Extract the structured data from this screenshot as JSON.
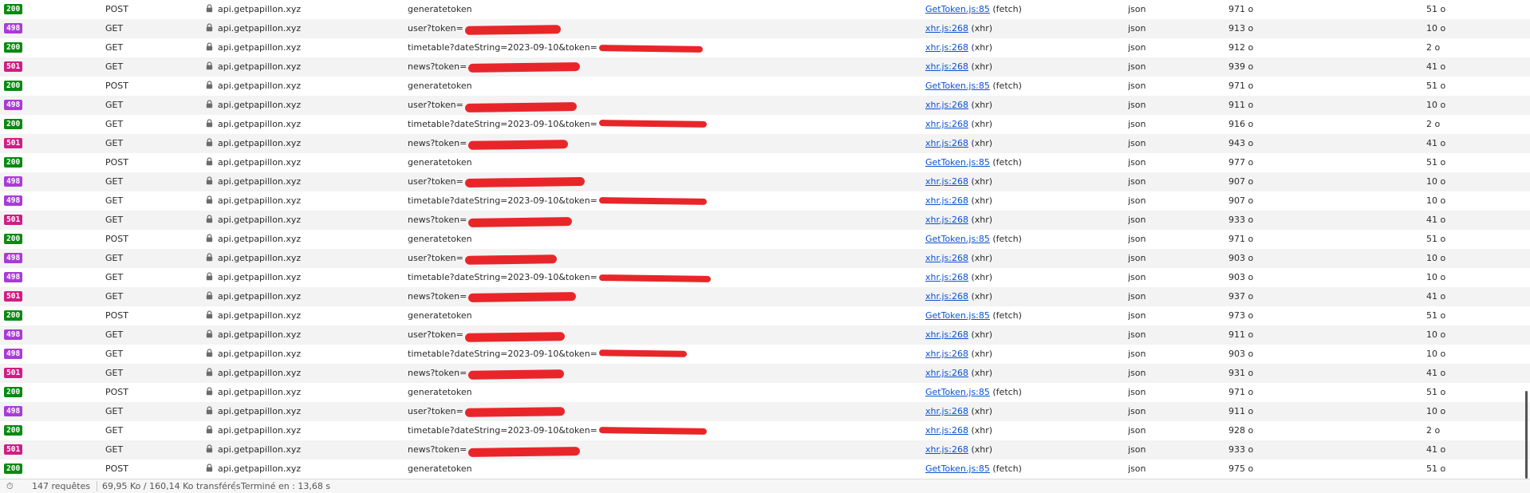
{
  "colors": {
    "ok": "#098a11",
    "blocked": "#a83bd8",
    "server_error": "#cf1d84",
    "link": "#0b52d0",
    "redaction": "#e8262a"
  },
  "rows": [
    {
      "status": "200",
      "method": "POST",
      "domain": "api.getpapillon.xyz",
      "file": "generatetoken",
      "initiator_link": "GetToken.js:85",
      "initiator_kind": "(fetch)",
      "type": "json",
      "transferred": "971 o",
      "size": "51 o",
      "redact": false
    },
    {
      "status": "498",
      "method": "GET",
      "domain": "api.getpapillon.xyz",
      "file": "user?token=",
      "initiator_link": "xhr.js:268",
      "initiator_kind": "(xhr)",
      "type": "json",
      "transferred": "913 o",
      "size": "10 o",
      "redact": true
    },
    {
      "status": "200",
      "method": "GET",
      "domain": "api.getpapillon.xyz",
      "file": "timetable?dateString=2023-09-10&token=",
      "initiator_link": "xhr.js:268",
      "initiator_kind": "(xhr)",
      "type": "json",
      "transferred": "912 o",
      "size": "2 o",
      "redact": true
    },
    {
      "status": "501",
      "method": "GET",
      "domain": "api.getpapillon.xyz",
      "file": "news?token=",
      "initiator_link": "xhr.js:268",
      "initiator_kind": "(xhr)",
      "type": "json",
      "transferred": "939 o",
      "size": "41 o",
      "redact": true
    },
    {
      "status": "200",
      "method": "POST",
      "domain": "api.getpapillon.xyz",
      "file": "generatetoken",
      "initiator_link": "GetToken.js:85",
      "initiator_kind": "(fetch)",
      "type": "json",
      "transferred": "971 o",
      "size": "51 o",
      "redact": false
    },
    {
      "status": "498",
      "method": "GET",
      "domain": "api.getpapillon.xyz",
      "file": "user?token=",
      "initiator_link": "xhr.js:268",
      "initiator_kind": "(xhr)",
      "type": "json",
      "transferred": "911 o",
      "size": "10 o",
      "redact": true
    },
    {
      "status": "200",
      "method": "GET",
      "domain": "api.getpapillon.xyz",
      "file": "timetable?dateString=2023-09-10&token=",
      "initiator_link": "xhr.js:268",
      "initiator_kind": "(xhr)",
      "type": "json",
      "transferred": "916 o",
      "size": "2 o",
      "redact": true
    },
    {
      "status": "501",
      "method": "GET",
      "domain": "api.getpapillon.xyz",
      "file": "news?token=",
      "initiator_link": "xhr.js:268",
      "initiator_kind": "(xhr)",
      "type": "json",
      "transferred": "943 o",
      "size": "41 o",
      "redact": true
    },
    {
      "status": "200",
      "method": "POST",
      "domain": "api.getpapillon.xyz",
      "file": "generatetoken",
      "initiator_link": "GetToken.js:85",
      "initiator_kind": "(fetch)",
      "type": "json",
      "transferred": "977 o",
      "size": "51 o",
      "redact": false
    },
    {
      "status": "498",
      "method": "GET",
      "domain": "api.getpapillon.xyz",
      "file": "user?token=",
      "initiator_link": "xhr.js:268",
      "initiator_kind": "(xhr)",
      "type": "json",
      "transferred": "907 o",
      "size": "10 o",
      "redact": true
    },
    {
      "status": "498",
      "method": "GET",
      "domain": "api.getpapillon.xyz",
      "file": "timetable?dateString=2023-09-10&token=",
      "initiator_link": "xhr.js:268",
      "initiator_kind": "(xhr)",
      "type": "json",
      "transferred": "907 o",
      "size": "10 o",
      "redact": true
    },
    {
      "status": "501",
      "method": "GET",
      "domain": "api.getpapillon.xyz",
      "file": "news?token=",
      "initiator_link": "xhr.js:268",
      "initiator_kind": "(xhr)",
      "type": "json",
      "transferred": "933 o",
      "size": "41 o",
      "redact": true
    },
    {
      "status": "200",
      "method": "POST",
      "domain": "api.getpapillon.xyz",
      "file": "generatetoken",
      "initiator_link": "GetToken.js:85",
      "initiator_kind": "(fetch)",
      "type": "json",
      "transferred": "971 o",
      "size": "51 o",
      "redact": false
    },
    {
      "status": "498",
      "method": "GET",
      "domain": "api.getpapillon.xyz",
      "file": "user?token=",
      "initiator_link": "xhr.js:268",
      "initiator_kind": "(xhr)",
      "type": "json",
      "transferred": "903 o",
      "size": "10 o",
      "redact": true
    },
    {
      "status": "498",
      "method": "GET",
      "domain": "api.getpapillon.xyz",
      "file": "timetable?dateString=2023-09-10&token=",
      "initiator_link": "xhr.js:268",
      "initiator_kind": "(xhr)",
      "type": "json",
      "transferred": "903 o",
      "size": "10 o",
      "redact": true
    },
    {
      "status": "501",
      "method": "GET",
      "domain": "api.getpapillon.xyz",
      "file": "news?token=",
      "initiator_link": "xhr.js:268",
      "initiator_kind": "(xhr)",
      "type": "json",
      "transferred": "937 o",
      "size": "41 o",
      "redact": true
    },
    {
      "status": "200",
      "method": "POST",
      "domain": "api.getpapillon.xyz",
      "file": "generatetoken",
      "initiator_link": "GetToken.js:85",
      "initiator_kind": "(fetch)",
      "type": "json",
      "transferred": "973 o",
      "size": "51 o",
      "redact": false
    },
    {
      "status": "498",
      "method": "GET",
      "domain": "api.getpapillon.xyz",
      "file": "user?token=",
      "initiator_link": "xhr.js:268",
      "initiator_kind": "(xhr)",
      "type": "json",
      "transferred": "911 o",
      "size": "10 o",
      "redact": true
    },
    {
      "status": "498",
      "method": "GET",
      "domain": "api.getpapillon.xyz",
      "file": "timetable?dateString=2023-09-10&token=",
      "initiator_link": "xhr.js:268",
      "initiator_kind": "(xhr)",
      "type": "json",
      "transferred": "903 o",
      "size": "10 o",
      "redact": true
    },
    {
      "status": "501",
      "method": "GET",
      "domain": "api.getpapillon.xyz",
      "file": "news?token=",
      "initiator_link": "xhr.js:268",
      "initiator_kind": "(xhr)",
      "type": "json",
      "transferred": "931 o",
      "size": "41 o",
      "redact": true
    },
    {
      "status": "200",
      "method": "POST",
      "domain": "api.getpapillon.xyz",
      "file": "generatetoken",
      "initiator_link": "GetToken.js:85",
      "initiator_kind": "(fetch)",
      "type": "json",
      "transferred": "971 o",
      "size": "51 o",
      "redact": false
    },
    {
      "status": "498",
      "method": "GET",
      "domain": "api.getpapillon.xyz",
      "file": "user?token=",
      "initiator_link": "xhr.js:268",
      "initiator_kind": "(xhr)",
      "type": "json",
      "transferred": "911 o",
      "size": "10 o",
      "redact": true
    },
    {
      "status": "200",
      "method": "GET",
      "domain": "api.getpapillon.xyz",
      "file": "timetable?dateString=2023-09-10&token=",
      "initiator_link": "xhr.js:268",
      "initiator_kind": "(xhr)",
      "type": "json",
      "transferred": "928 o",
      "size": "2 o",
      "redact": true
    },
    {
      "status": "501",
      "method": "GET",
      "domain": "api.getpapillon.xyz",
      "file": "news?token=",
      "initiator_link": "xhr.js:268",
      "initiator_kind": "(xhr)",
      "type": "json",
      "transferred": "933 o",
      "size": "41 o",
      "redact": true
    },
    {
      "status": "200",
      "method": "POST",
      "domain": "api.getpapillon.xyz",
      "file": "generatetoken",
      "initiator_link": "GetToken.js:85",
      "initiator_kind": "(fetch)",
      "type": "json",
      "transferred": "975 o",
      "size": "51 o",
      "redact": false
    }
  ],
  "status_bar": {
    "requests": "147 requêtes",
    "transferred": "69,95 Ko / 160,14 Ko transférés",
    "finished": "Terminé en : 13,68 s"
  }
}
